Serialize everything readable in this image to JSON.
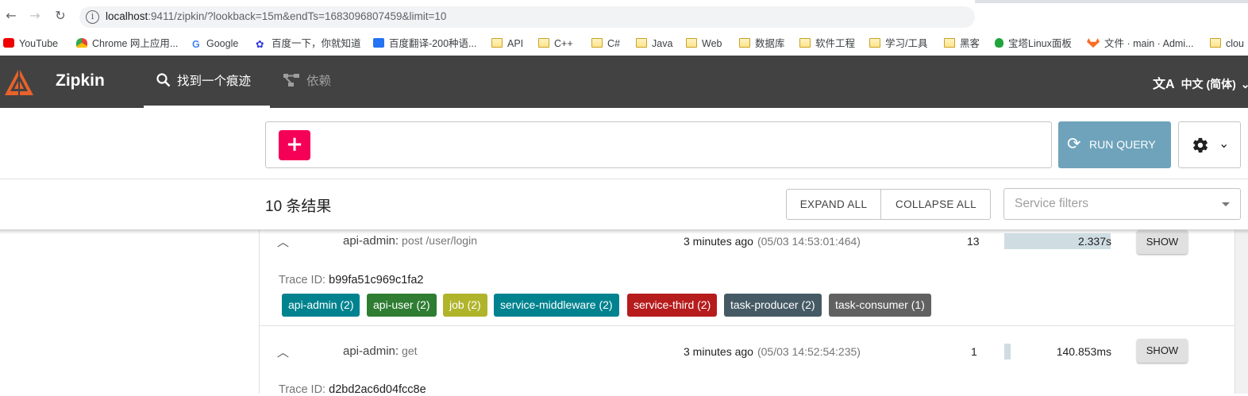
{
  "browser": {
    "url_host": "localhost",
    "url_rest": ":9411/zipkin/?lookback=15m&endTs=1683096807459&limit=10",
    "bookmarks": [
      {
        "label": "YouTube",
        "icon": "youtube-icon"
      },
      {
        "label": "Chrome 网上应用...",
        "icon": "chrome-web-store-icon"
      },
      {
        "label": "Google",
        "icon": "google-icon"
      },
      {
        "label": "百度一下，你就知道",
        "icon": "baidu-icon"
      },
      {
        "label": "百度翻译-200种语...",
        "icon": "baidu-translate-icon"
      },
      {
        "label": "API",
        "icon": "folder-icon"
      },
      {
        "label": "C++",
        "icon": "folder-icon"
      },
      {
        "label": "C#",
        "icon": "folder-icon"
      },
      {
        "label": "Java",
        "icon": "folder-icon"
      },
      {
        "label": "Web",
        "icon": "folder-icon"
      },
      {
        "label": "数据库",
        "icon": "folder-icon"
      },
      {
        "label": "软件工程",
        "icon": "folder-icon"
      },
      {
        "label": "学习/工具",
        "icon": "folder-icon"
      },
      {
        "label": "黑客",
        "icon": "folder-icon"
      },
      {
        "label": "宝塔Linux面板",
        "icon": "baota-icon"
      },
      {
        "label": "文件 · main · Admi...",
        "icon": "gitlab-icon"
      },
      {
        "label": "clou",
        "icon": "folder-icon"
      }
    ]
  },
  "app": {
    "brand": "Zipkin",
    "tabs": [
      {
        "label": "找到一个痕迹",
        "icon": "search-icon",
        "active": true
      },
      {
        "label": "依赖",
        "icon": "dependency-graph-icon",
        "active": false
      }
    ],
    "language": "中文 (简体)"
  },
  "query": {
    "add_label": "+",
    "run_label": "RUN QUERY"
  },
  "results": {
    "count_label": "10 条结果",
    "expand_all": "EXPAND ALL",
    "collapse_all": "COLLAPSE ALL",
    "service_filter_placeholder": "Service filters",
    "traces": [
      {
        "service": "api-admin:",
        "operation": "post /user/login",
        "ago": "3 minutes ago",
        "timestamp": "(05/03 14:53:01:464)",
        "spans": "13",
        "duration": "2.337s",
        "duration_fraction": 1.0,
        "show_label": "SHOW",
        "trace_id_label": "Trace ID:",
        "trace_id": "b99fa51c969c1fa2",
        "tags": [
          {
            "label": "api-admin (2)",
            "color": "#00838f"
          },
          {
            "label": "api-user (2)",
            "color": "#2e7d32"
          },
          {
            "label": "job (2)",
            "color": "#afb42b"
          },
          {
            "label": "service-middleware (2)",
            "color": "#00838f"
          },
          {
            "label": "service-third (2)",
            "color": "#b71c1c"
          },
          {
            "label": "task-producer (2)",
            "color": "#455a64"
          },
          {
            "label": "task-consumer (1)",
            "color": "#616161"
          }
        ]
      },
      {
        "service": "api-admin:",
        "operation": "get",
        "ago": "3 minutes ago",
        "timestamp": "(05/03 14:52:54:235)",
        "spans": "1",
        "duration": "140.853ms",
        "duration_fraction": 0.06,
        "show_label": "SHOW",
        "trace_id_label": "Trace ID:",
        "trace_id": "d2bd2ac6d04fcc8e"
      }
    ]
  }
}
